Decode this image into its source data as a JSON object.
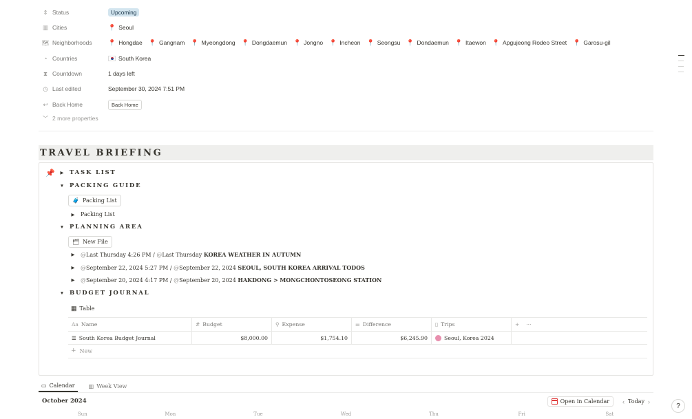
{
  "properties": {
    "status": {
      "label": "Status",
      "value": "Upcoming"
    },
    "cities": {
      "label": "Cities",
      "value": "Seoul"
    },
    "neighborhoods": {
      "label": "Neighborhoods",
      "items": [
        "Hongdae",
        "Gangnam",
        "Myeongdong",
        "Dongdaemun",
        "Jongno",
        "Incheon",
        "Seongsu",
        "Dondaemun",
        "Itaewon",
        "Apgujeong Rodeo Street",
        "Garosu-gil"
      ]
    },
    "countries": {
      "label": "Countries",
      "value": "South Korea"
    },
    "countdown": {
      "label": "Countdown",
      "value": "1 days left"
    },
    "last_edited": {
      "label": "Last edited",
      "value": "September 30, 2024 7:51 PM"
    },
    "back_home": {
      "label": "Back Home",
      "button": "Back Home"
    },
    "more": "2 more properties"
  },
  "briefing": {
    "title": "TRAVEL BRIEFING",
    "task_list": "TASK LIST",
    "packing_guide": {
      "title": "PACKING GUIDE",
      "button": "Packing List",
      "toggle": "Packing List"
    },
    "planning_area": {
      "title": "PLANNING AREA",
      "button": "New File",
      "items": [
        {
          "d1": "Last Thursday 4:26 PM",
          "d2": "Last Thursday",
          "title": "KOREA WEATHER IN AUTUMN"
        },
        {
          "d1": "September 22, 2024 5:27 PM",
          "d2": "September 22, 2024",
          "title": "SEOUL, SOUTH KOREA ARRIVAL TODOS"
        },
        {
          "d1": "September 20, 2024 4:17 PM",
          "d2": "September 20, 2024",
          "title": "HAKDONG > MONGCHONTOSEONG STATION"
        }
      ]
    },
    "budget_journal": {
      "title": "BUDGET JOURNAL",
      "view": "Table",
      "columns": {
        "name": "Name",
        "budget": "Budget",
        "expense": "Expense",
        "difference": "Difference",
        "trips": "Trips"
      },
      "rows": [
        {
          "name": "South Korea Budget Journal",
          "budget": "$8,000.00",
          "expense": "$1,754.10",
          "difference": "$6,245.90",
          "trip": "Seoul, Korea 2024"
        }
      ],
      "new": "New"
    }
  },
  "calendar": {
    "tabs": [
      "Calendar",
      "Week View"
    ],
    "month": "October 2024",
    "open": "Open in Calendar",
    "today": "Today",
    "weekdays": [
      "Sun",
      "Mon",
      "Tue",
      "Wed",
      "Thu",
      "Fri",
      "Sat"
    ]
  },
  "icons": {
    "status": "status-icon",
    "cities": "building-icon",
    "neighborhoods": "map-icon",
    "countries": "globe-icon",
    "countdown": "hourglass-icon",
    "last_edited": "clock-icon",
    "back_home": "reply-icon",
    "pin": "pushpin-icon"
  }
}
